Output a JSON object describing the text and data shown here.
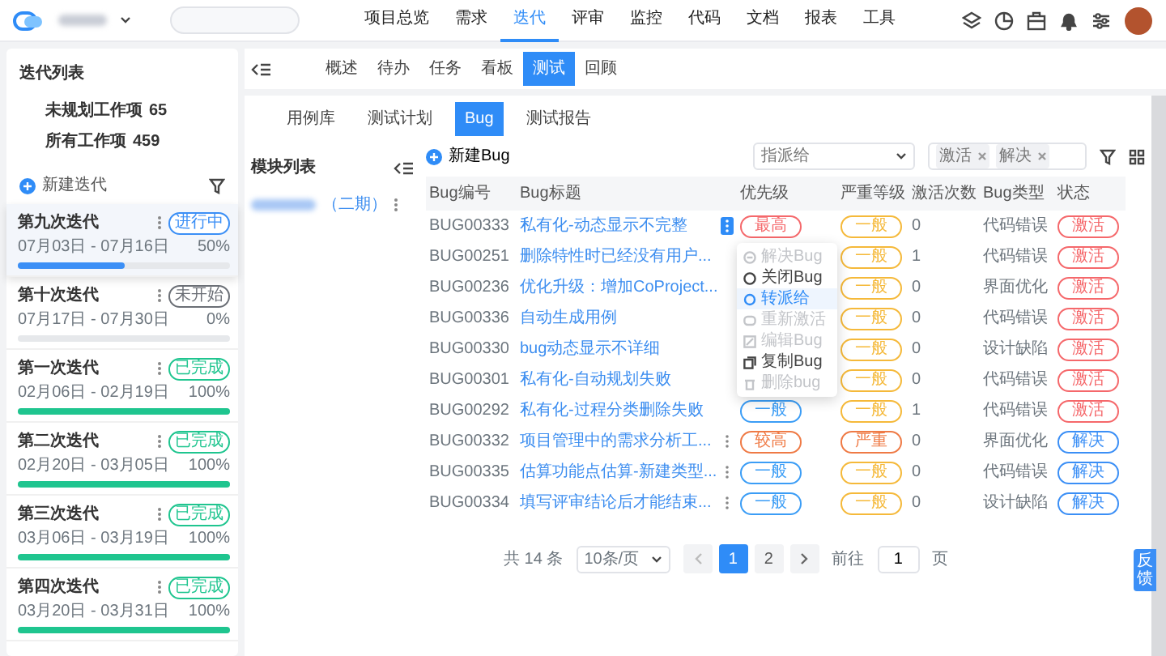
{
  "top_nav": {
    "items": [
      {
        "label": "项目总览",
        "selected": false
      },
      {
        "label": "需求",
        "selected": false
      },
      {
        "label": "迭代",
        "selected": true
      },
      {
        "label": "评审",
        "selected": false
      },
      {
        "label": "监控",
        "selected": false
      },
      {
        "label": "代码",
        "selected": false
      },
      {
        "label": "文档",
        "selected": false
      },
      {
        "label": "报表",
        "selected": false
      },
      {
        "label": "工具",
        "selected": false
      }
    ]
  },
  "sidebar": {
    "title": "迭代列表",
    "stats": [
      {
        "label": "未规划工作项",
        "count": "65"
      },
      {
        "label": "所有工作项",
        "count": "459"
      }
    ],
    "new_button": "新建迭代",
    "iterations": [
      {
        "name": "第九次迭代",
        "dates": "07月03日 - 07月16日",
        "status": {
          "text": "进行中",
          "color": "#3b8ff6"
        },
        "percent": "50%",
        "level": 0.5,
        "selected": true
      },
      {
        "name": "第十次迭代",
        "dates": "07月17日 - 07月30日",
        "status": {
          "text": "未开始",
          "color": "#6b6f76"
        },
        "percent": "0%",
        "level": 0,
        "selected": false
      },
      {
        "name": "第一次迭代",
        "dates": "02月06日 - 02月19日",
        "status": {
          "text": "已完成",
          "color": "#1fc58f"
        },
        "percent": "100%",
        "level": 1,
        "selected": false
      },
      {
        "name": "第二次迭代",
        "dates": "02月20日 - 03月05日",
        "status": {
          "text": "已完成",
          "color": "#1fc58f"
        },
        "percent": "100%",
        "level": 1,
        "selected": false
      },
      {
        "name": "第三次迭代",
        "dates": "03月06日 - 03月19日",
        "status": {
          "text": "已完成",
          "color": "#1fc58f"
        },
        "percent": "100%",
        "level": 1,
        "selected": false
      },
      {
        "name": "第四次迭代",
        "dates": "03月20日 - 03月31日",
        "status": {
          "text": "已完成",
          "color": "#1fc58f"
        },
        "percent": "100%",
        "level": 1,
        "selected": false
      }
    ]
  },
  "tabs": [
    {
      "label": "概述",
      "selected": false
    },
    {
      "label": "待办",
      "selected": false
    },
    {
      "label": "任务",
      "selected": false
    },
    {
      "label": "看板",
      "selected": false
    },
    {
      "label": "测试",
      "selected": true
    },
    {
      "label": "回顾",
      "selected": false
    }
  ],
  "sub_tabs": [
    {
      "label": "用例库",
      "selected": false
    },
    {
      "label": "测试计划",
      "selected": false
    },
    {
      "label": "Bug",
      "selected": true
    },
    {
      "label": "测试报告",
      "selected": false
    }
  ],
  "module_panel": {
    "title": "模块列表",
    "item": "（二期）"
  },
  "toolbar": {
    "new_button": "新建Bug",
    "assignee_filter": {
      "placeholder": "指派给"
    },
    "status_filter": {
      "tags": [
        "激活",
        "解决"
      ]
    }
  },
  "table": {
    "columns": [
      "Bug编号",
      "Bug标题",
      "优先级",
      "严重等级",
      "激活次数",
      "Bug类型",
      "状态"
    ],
    "rows": [
      {
        "id": "BUG00333",
        "title": "私有化-动态显示不完整",
        "menu_open": true,
        "priority": {
          "text": "最高",
          "color": "#f5686b"
        },
        "severity": {
          "text": "一般",
          "color": "#f5b93a"
        },
        "activations": "0",
        "type": "代码错误",
        "status": {
          "text": "激活",
          "color": "#f5686b"
        }
      },
      {
        "id": "BUG00251",
        "title": "删除特性时已经没有用户...",
        "severity": {
          "text": "一般",
          "color": "#f5b93a"
        },
        "activations": "1",
        "type": "代码错误",
        "status": {
          "text": "激活",
          "color": "#f5686b"
        }
      },
      {
        "id": "BUG00236",
        "title": "优化升级：增加CoProject...",
        "severity": {
          "text": "一般",
          "color": "#f5b93a"
        },
        "activations": "0",
        "type": "界面优化",
        "status": {
          "text": "激活",
          "color": "#f5686b"
        }
      },
      {
        "id": "BUG00336",
        "title": "自动生成用例",
        "severity": {
          "text": "一般",
          "color": "#f5b93a"
        },
        "activations": "0",
        "type": "代码错误",
        "status": {
          "text": "激活",
          "color": "#f5686b"
        }
      },
      {
        "id": "BUG00330",
        "title": "bug动态显示不详细",
        "severity": {
          "text": "一般",
          "color": "#f5b93a"
        },
        "activations": "0",
        "type": "设计缺陷",
        "status": {
          "text": "激活",
          "color": "#f5686b"
        }
      },
      {
        "id": "BUG00301",
        "title": "私有化-自动规划失败",
        "severity": {
          "text": "一般",
          "color": "#f5b93a"
        },
        "activations": "0",
        "type": "代码错误",
        "status": {
          "text": "激活",
          "color": "#f5686b"
        }
      },
      {
        "id": "BUG00292",
        "title": "私有化-过程分类删除失败",
        "priority": {
          "text": "一般",
          "color": "#3b9df6"
        },
        "severity": {
          "text": "一般",
          "color": "#f5b93a"
        },
        "activations": "1",
        "type": "代码错误",
        "status": {
          "text": "激活",
          "color": "#f5686b"
        }
      },
      {
        "id": "BUG00332",
        "title": "项目管理中的需求分析工...",
        "menu_open": false,
        "priority": {
          "text": "较高",
          "color": "#ef7a45"
        },
        "severity": {
          "text": "严重",
          "color": "#ef7a45"
        },
        "activations": "0",
        "type": "界面优化",
        "status": {
          "text": "解决",
          "color": "#3b8ff6"
        }
      },
      {
        "id": "BUG00335",
        "title": "估算功能点估算-新建类型...",
        "menu_open": false,
        "priority": {
          "text": "一般",
          "color": "#3b9df6"
        },
        "severity": {
          "text": "一般",
          "color": "#f5b93a"
        },
        "activations": "0",
        "type": "代码错误",
        "status": {
          "text": "解决",
          "color": "#3b8ff6"
        }
      },
      {
        "id": "BUG00334",
        "title": "填写评审结论后才能结束...",
        "menu_open": false,
        "priority": {
          "text": "一般",
          "color": "#3b9df6"
        },
        "severity": {
          "text": "一般",
          "color": "#f5b93a"
        },
        "activations": "0",
        "type": "设计缺陷",
        "status": {
          "text": "解决",
          "color": "#3b8ff6"
        }
      }
    ]
  },
  "row_menu": {
    "items": [
      {
        "label": "解决Bug",
        "kind": "resolve",
        "disabled": true,
        "selected": false
      },
      {
        "label": "关闭Bug",
        "kind": "close",
        "disabled": false,
        "selected": false
      },
      {
        "label": "转派给",
        "kind": "reassign",
        "disabled": false,
        "selected": true
      },
      {
        "label": "重新激活",
        "kind": "reactivate",
        "disabled": true,
        "selected": false
      },
      {
        "label": "编辑Bug",
        "kind": "edit",
        "disabled": true,
        "selected": false
      },
      {
        "label": "复制Bug",
        "kind": "copy",
        "disabled": false,
        "selected": false
      },
      {
        "label": "删除bug",
        "kind": "delete",
        "disabled": true,
        "selected": false
      }
    ]
  },
  "pagination": {
    "total": "共 14 条",
    "page_size": "10条/页",
    "pages": [
      {
        "label": "1",
        "selected": true
      },
      {
        "label": "2",
        "selected": false
      }
    ],
    "goto_label": "前往",
    "goto_value": "1",
    "goto_suffix": "页"
  },
  "feedback": "反馈"
}
